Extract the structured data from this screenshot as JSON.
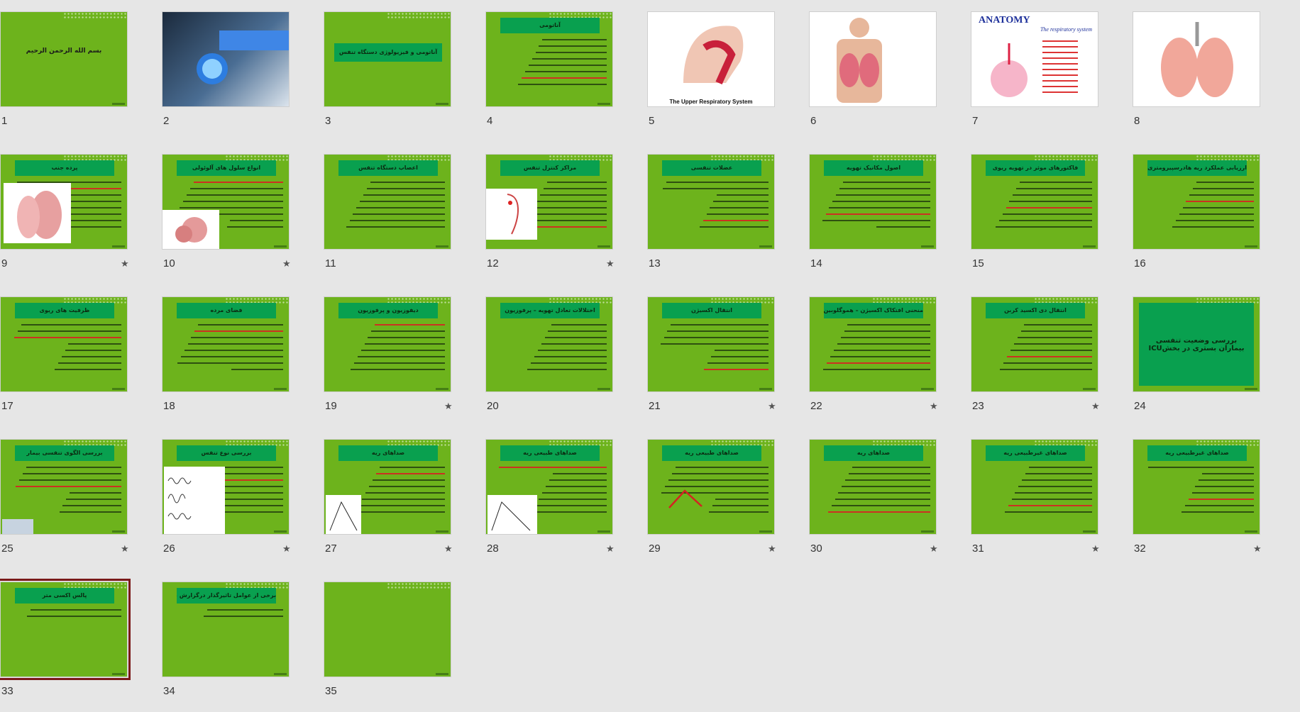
{
  "colors": {
    "slide_green": "#6db31c",
    "title_green": "#09a04f",
    "selected_border": "#7a1a1a",
    "background": "#e6e6e6"
  },
  "slides": [
    {
      "num": "1",
      "kind": "title",
      "text": "بسم الله الرحمن الرحیم",
      "star": false
    },
    {
      "num": "2",
      "kind": "image",
      "star": false
    },
    {
      "num": "3",
      "kind": "box",
      "text": "آناتومی و فیزیولوژی دستگاه تنفس",
      "star": false
    },
    {
      "num": "4",
      "kind": "text",
      "title": "آناتومی",
      "star": false
    },
    {
      "num": "5",
      "kind": "white",
      "caption": "The Upper Respiratory System",
      "star": false
    },
    {
      "num": "6",
      "kind": "white",
      "star": false
    },
    {
      "num": "7",
      "kind": "white",
      "heading": "ANATOMY",
      "sub": "The respiratory system",
      "star": false
    },
    {
      "num": "8",
      "kind": "white",
      "star": false
    },
    {
      "num": "9",
      "kind": "text",
      "title": "پرده جنب",
      "star": true
    },
    {
      "num": "10",
      "kind": "text",
      "title": "انواع سلول های آلوئولی",
      "star": true
    },
    {
      "num": "11",
      "kind": "text",
      "title": "اعصاب دستگاه تنفس",
      "star": false
    },
    {
      "num": "12",
      "kind": "text",
      "title": "مراکز کنترل تنفس",
      "star": true
    },
    {
      "num": "13",
      "kind": "text",
      "title": "عضلات تنفسی",
      "star": false
    },
    {
      "num": "14",
      "kind": "text",
      "title": "اصول مکانیک تهویه",
      "star": false
    },
    {
      "num": "15",
      "kind": "text",
      "title": "فاکتورهای موثر در تهویه ریوی",
      "star": false
    },
    {
      "num": "16",
      "kind": "text",
      "title": "ارزیابی عملکرد ریه هادرسپیرومتری)",
      "star": false
    },
    {
      "num": "17",
      "kind": "text",
      "title": "ظرفیت های ریوی",
      "star": false
    },
    {
      "num": "18",
      "kind": "text",
      "title": "فضای مرده",
      "star": false
    },
    {
      "num": "19",
      "kind": "text",
      "title": "دیفوزیون و پرفوزیون",
      "star": true
    },
    {
      "num": "20",
      "kind": "text",
      "title": "اختلالات تعادل تهویه – پرفوزیون",
      "star": false
    },
    {
      "num": "21",
      "kind": "text",
      "title": "انتقال اکسیژن",
      "star": true
    },
    {
      "num": "22",
      "kind": "text",
      "title": "منحنی افتکاک اکسیژن – هموگلوبین",
      "star": true
    },
    {
      "num": "23",
      "kind": "text",
      "title": "انتقال دی اکسید کربن",
      "star": true
    },
    {
      "num": "24",
      "kind": "box",
      "text": "بررسی وضعیت تنفسی بیماران بستری در بخشICU",
      "star": false
    },
    {
      "num": "25",
      "kind": "text",
      "title": "بررسی الگوی تنفسی بیمار",
      "star": true
    },
    {
      "num": "26",
      "kind": "text",
      "title": "بررسی نوع تنفس",
      "star": true
    },
    {
      "num": "27",
      "kind": "text",
      "title": "صداهای ریه",
      "star": true
    },
    {
      "num": "28",
      "kind": "text",
      "title": "صداهای طبیعی ریه",
      "star": true
    },
    {
      "num": "29",
      "kind": "text",
      "title": "صداهای طبیعی ریه",
      "star": true
    },
    {
      "num": "30",
      "kind": "text",
      "title": "صداهای ریه",
      "star": true
    },
    {
      "num": "31",
      "kind": "text",
      "title": "صداهای غیرطبیعی ریه",
      "star": true
    },
    {
      "num": "32",
      "kind": "text",
      "title": "صداهای غیرطبیعی ریه",
      "star": true
    },
    {
      "num": "33",
      "kind": "text",
      "title": "پالس اکسی متر",
      "star": false,
      "selected": true
    },
    {
      "num": "34",
      "kind": "text",
      "title": "برخی از عوامل تاثیرگذار درگزارش غلط SpO2",
      "star": false
    },
    {
      "num": "35",
      "kind": "blank",
      "star": false
    }
  ]
}
